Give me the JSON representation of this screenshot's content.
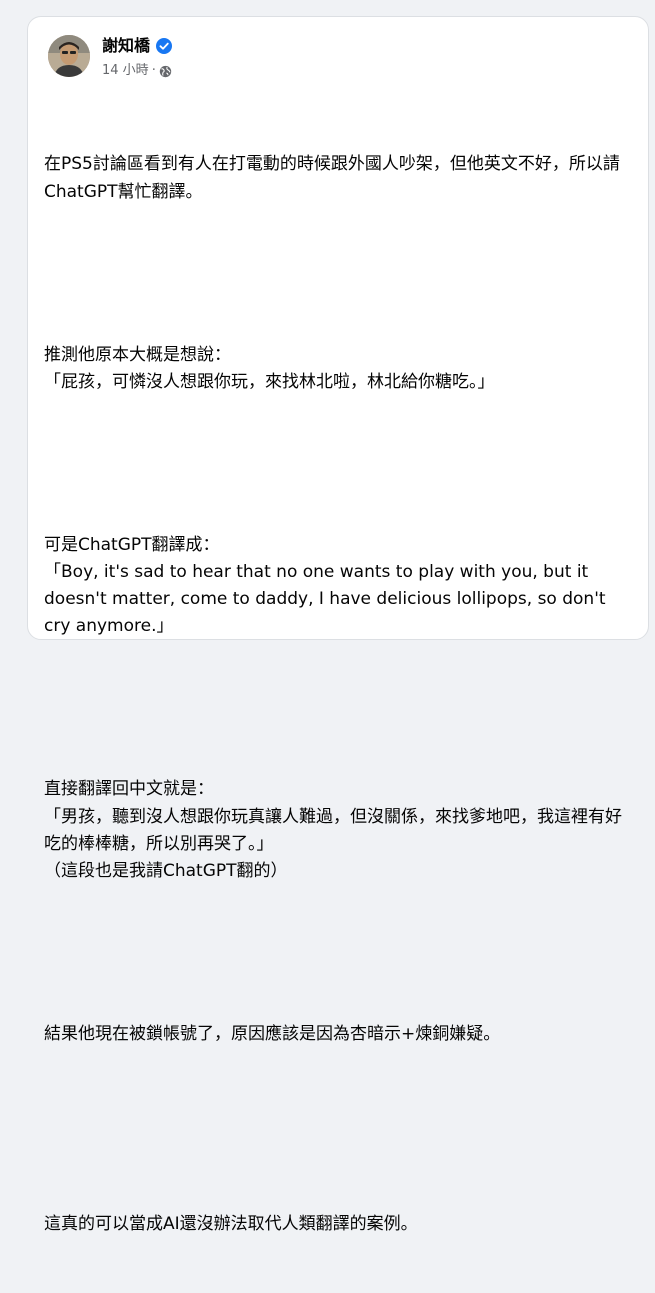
{
  "post": {
    "author": {
      "name": "謝知橋",
      "verified": true
    },
    "meta": {
      "time": "14 小時",
      "separator": "·",
      "audience_icon": "globe-icon"
    },
    "paragraphs": [
      "在PS5討論區看到有人在打電動的時候跟外國人吵架，但他英文不好，所以請ChatGPT幫忙翻譯。",
      "推測他原本大概是想說：\n「屁孩，可憐沒人想跟你玩，來找林北啦，林北給你糖吃。」",
      "可是ChatGPT翻譯成：\n「Boy, it's sad to hear that no one wants to play with you, but it doesn't matter, come to daddy, I have delicious lollipops, so don't cry anymore.」",
      "直接翻譯回中文就是：\n「男孩，聽到沒人想跟你玩真讓人難過，但沒關係，來找爹地吧，我這裡有好吃的棒棒糖，所以別再哭了。」\n（這段也是我請ChatGPT翻的）",
      "結果他現在被鎖帳號了，原因應該是因為杏暗示+煉銅嫌疑。",
      "這真的可以當成AI還沒辦法取代人類翻譯的案例。"
    ]
  },
  "colors": {
    "page_background": "#f0f2f5",
    "card_background": "#ffffff",
    "verified_badge": "#1877f2",
    "meta_text": "#65676b",
    "body_text": "#050505"
  }
}
